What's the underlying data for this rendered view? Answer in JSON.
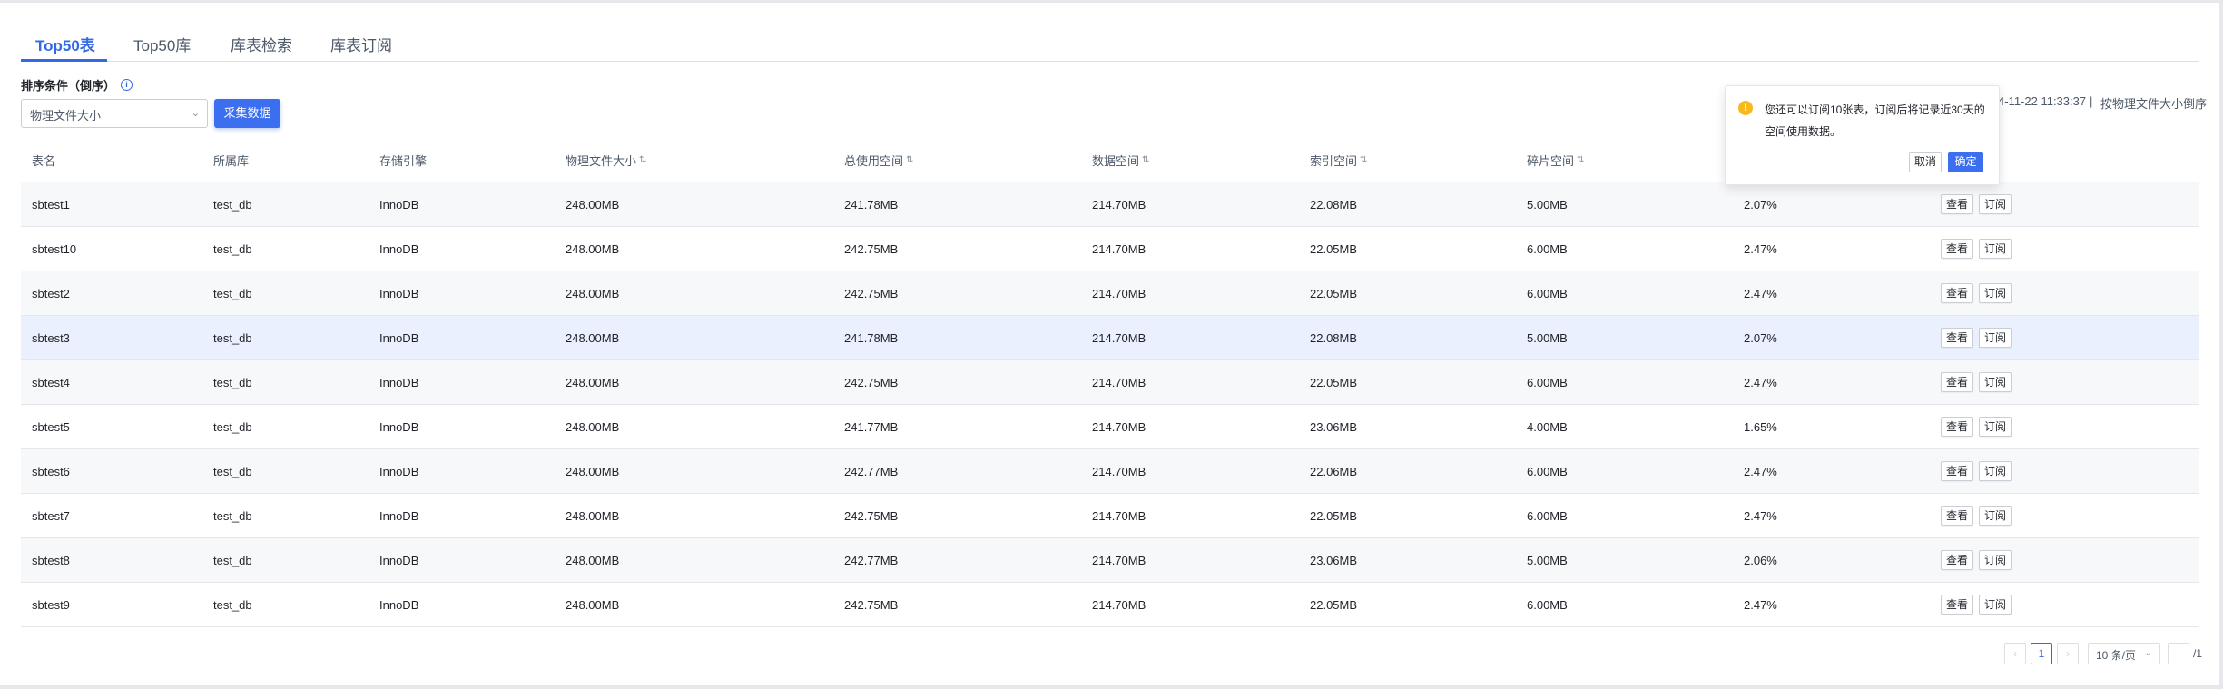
{
  "tabs": [
    "Top50表",
    "Top50库",
    "库表检索",
    "库表订阅"
  ],
  "sort": {
    "label": "排序条件（倒序）",
    "selected": "物理文件大小",
    "collect_button": "采集数据"
  },
  "meta": {
    "time_partial": "4-11-22 11:33:37",
    "separator": "|",
    "order_note": "按物理文件大小倒序"
  },
  "columns": [
    "表名",
    "所属库",
    "存储引擎",
    "物理文件大小",
    "总使用空间",
    "数据空间",
    "索引空间",
    "碎片空间",
    "",
    ""
  ],
  "sortable_columns": [
    3,
    4,
    5,
    6,
    7
  ],
  "rows": [
    [
      "sbtest1",
      "test_db",
      "InnoDB",
      "248.00MB",
      "241.78MB",
      "214.70MB",
      "22.08MB",
      "5.00MB",
      "2.07%"
    ],
    [
      "sbtest10",
      "test_db",
      "InnoDB",
      "248.00MB",
      "242.75MB",
      "214.70MB",
      "22.05MB",
      "6.00MB",
      "2.47%"
    ],
    [
      "sbtest2",
      "test_db",
      "InnoDB",
      "248.00MB",
      "242.75MB",
      "214.70MB",
      "22.05MB",
      "6.00MB",
      "2.47%"
    ],
    [
      "sbtest3",
      "test_db",
      "InnoDB",
      "248.00MB",
      "241.78MB",
      "214.70MB",
      "22.08MB",
      "5.00MB",
      "2.07%"
    ],
    [
      "sbtest4",
      "test_db",
      "InnoDB",
      "248.00MB",
      "242.75MB",
      "214.70MB",
      "22.05MB",
      "6.00MB",
      "2.47%"
    ],
    [
      "sbtest5",
      "test_db",
      "InnoDB",
      "248.00MB",
      "241.77MB",
      "214.70MB",
      "23.06MB",
      "4.00MB",
      "1.65%"
    ],
    [
      "sbtest6",
      "test_db",
      "InnoDB",
      "248.00MB",
      "242.77MB",
      "214.70MB",
      "22.06MB",
      "6.00MB",
      "2.47%"
    ],
    [
      "sbtest7",
      "test_db",
      "InnoDB",
      "248.00MB",
      "242.75MB",
      "214.70MB",
      "22.05MB",
      "6.00MB",
      "2.47%"
    ],
    [
      "sbtest8",
      "test_db",
      "InnoDB",
      "248.00MB",
      "242.77MB",
      "214.70MB",
      "23.06MB",
      "5.00MB",
      "2.06%"
    ],
    [
      "sbtest9",
      "test_db",
      "InnoDB",
      "248.00MB",
      "242.75MB",
      "214.70MB",
      "22.05MB",
      "6.00MB",
      "2.47%"
    ]
  ],
  "row_actions": [
    "查看",
    "订阅"
  ],
  "popconfirm": {
    "message": "您还可以订阅10张表，订阅后将记录近30天的空间使用数据。",
    "cancel": "取消",
    "ok": "确定"
  },
  "pagination": {
    "prev": "‹",
    "current": "1",
    "next": "›",
    "page_size": "10 条/页",
    "total": "/1"
  },
  "colors": {
    "primary": "#3369e5",
    "warning": "#f7ba1e",
    "row_highlight": "#eaf0fd"
  }
}
